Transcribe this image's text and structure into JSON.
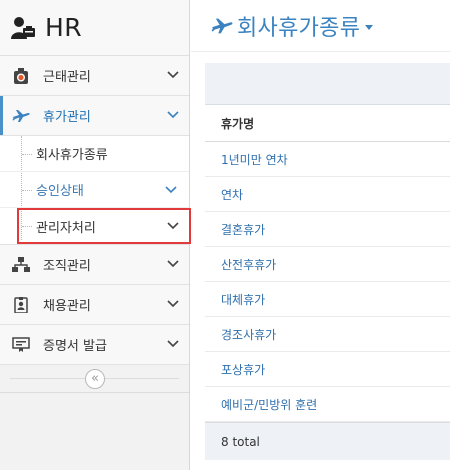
{
  "brand": {
    "title": "HR"
  },
  "sidebar": {
    "items": [
      {
        "label": "근태관리",
        "icon": "clock-icon"
      },
      {
        "label": "휴가관리",
        "icon": "plane-icon"
      },
      {
        "label": "조직관리",
        "icon": "org-chart-icon"
      },
      {
        "label": "채용관리",
        "icon": "id-badge-icon"
      },
      {
        "label": "증명서 발급",
        "icon": "certificate-icon"
      }
    ],
    "submenu": [
      {
        "label": "회사휴가종류"
      },
      {
        "label": "승인상태"
      },
      {
        "label": "관리자처리"
      }
    ],
    "collapse_label": "«"
  },
  "header": {
    "title": "회사휴가종류"
  },
  "table": {
    "column_header": "휴가명",
    "rows": [
      "1년미만 연차",
      "연차",
      "결혼휴가",
      "산전후휴가",
      "대체휴가",
      "경조사휴가",
      "포상휴가",
      "예비군/민방위 훈련"
    ],
    "footer": "8 total"
  },
  "colors": {
    "accent": "#3b83c0",
    "highlight_border": "#e23a3a",
    "link": "#2f6fad"
  }
}
